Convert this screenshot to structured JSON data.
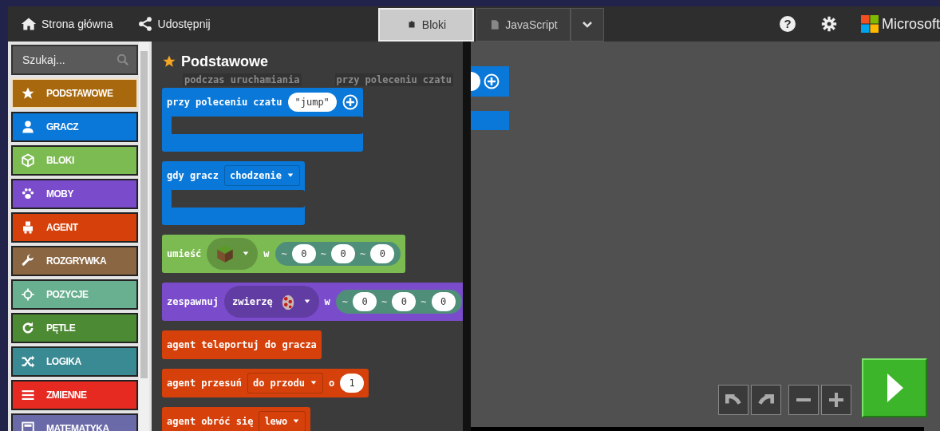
{
  "top_bar": {
    "nav": [
      {
        "label": "Strona główna"
      },
      {
        "label": "Udostępnij"
      }
    ],
    "editor_tabs": [
      {
        "label": "Bloki",
        "selected": true
      },
      {
        "label": "JavaScript",
        "selected": false
      }
    ],
    "help": "?",
    "brand": "Microsoft"
  },
  "toolbox": {
    "search": {
      "placeholder": "Szukaj..."
    },
    "categories": [
      {
        "label": "PODSTAWOWE",
        "color": "#a8680e",
        "selected": true
      },
      {
        "label": "GRACZ",
        "color": "#0a78d8",
        "selected": false
      },
      {
        "label": "BLOKI",
        "color": "#7cbb52",
        "selected": false
      },
      {
        "label": "MOBY",
        "color": "#7a4ccb",
        "selected": false
      },
      {
        "label": "AGENT",
        "color": "#d6400a",
        "selected": false
      },
      {
        "label": "ROZGRYWKA",
        "color": "#8a6742",
        "selected": false
      },
      {
        "label": "POZYCJE",
        "color": "#68b08f",
        "selected": false
      },
      {
        "label": "PĘTLE",
        "color": "#4d8a34",
        "selected": false
      },
      {
        "label": "LOGIKA",
        "color": "#3a8a94",
        "selected": false
      },
      {
        "label": "ZMIENNE",
        "color": "#e62a22",
        "selected": false
      },
      {
        "label": "MATEMATYKA",
        "color": "#6a6aa8",
        "selected": false
      }
    ]
  },
  "flyout": {
    "title": "Podstawowe",
    "ghost_labels": [
      "podczas uruchamiania",
      "przy poleceniu czatu"
    ],
    "blocks": [
      {
        "kind": "event",
        "color": "#0a78d8",
        "parts": [
          {
            "kind": "text",
            "text": "przy poleceniu czatu"
          },
          {
            "kind": "string",
            "text": "\"jump\""
          },
          {
            "kind": "plus"
          }
        ]
      },
      {
        "kind": "event",
        "color": "#0a78d8",
        "parts": [
          {
            "kind": "text",
            "text": "gdy gracz"
          },
          {
            "kind": "dropdown",
            "text": "chodzenie"
          }
        ]
      },
      {
        "kind": "statement",
        "color": "#7cbb52",
        "parts": [
          {
            "kind": "text",
            "text": "umieść"
          },
          {
            "kind": "block_dropdown"
          },
          {
            "kind": "text",
            "text": "w"
          },
          {
            "kind": "coords",
            "items": [
              {
                "prefix": "~",
                "value": "0"
              },
              {
                "prefix": "~",
                "value": "0"
              },
              {
                "prefix": "~",
                "value": "0"
              }
            ]
          }
        ]
      },
      {
        "kind": "statement",
        "color": "#7a4ccb",
        "parts": [
          {
            "kind": "text",
            "text": "zespawnuj"
          },
          {
            "kind": "mob_dropdown",
            "text": "zwierzę"
          },
          {
            "kind": "text",
            "text": "w"
          },
          {
            "kind": "coords",
            "items": [
              {
                "prefix": "~",
                "value": "0"
              },
              {
                "prefix": "~",
                "value": "0"
              },
              {
                "prefix": "~",
                "value": "0"
              }
            ]
          }
        ]
      },
      {
        "kind": "statement",
        "color": "#d6400a",
        "parts": [
          {
            "kind": "text",
            "text": "agent teleportuj do gracza"
          }
        ]
      },
      {
        "kind": "statement",
        "color": "#d6400a",
        "parts": [
          {
            "kind": "text",
            "text": "agent przesuń"
          },
          {
            "kind": "dropdown",
            "text": "do przodu"
          },
          {
            "kind": "text",
            "text": "o"
          },
          {
            "kind": "number",
            "text": "1"
          }
        ]
      },
      {
        "kind": "statement",
        "color": "#d6400a",
        "parts": [
          {
            "kind": "text",
            "text": "agent obróć się"
          },
          {
            "kind": "dropdown",
            "text": "lewo"
          }
        ]
      }
    ]
  }
}
